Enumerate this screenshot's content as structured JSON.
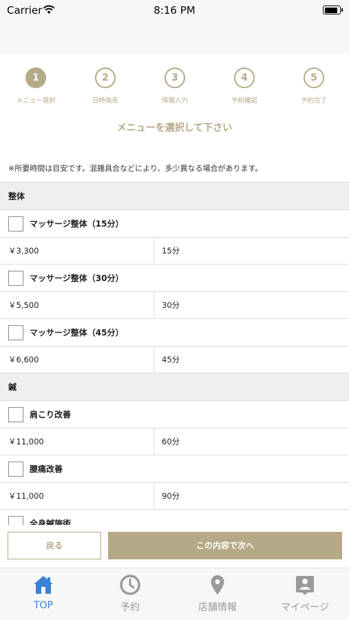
{
  "status_bar": {
    "carrier": "Carrier",
    "time": "8:16 PM"
  },
  "steps": [
    {
      "number": "1",
      "label": "メニュー選択"
    },
    {
      "number": "2",
      "label": "日時指名"
    },
    {
      "number": "3",
      "label": "情報入力"
    },
    {
      "number": "4",
      "label": "予約確認"
    },
    {
      "number": "5",
      "label": "予約完了"
    }
  ],
  "heading": "メニューを選択して下さい",
  "notice": "※所要時間は目安です。混雑具合などにより、多少異なる場合があります。",
  "categories": [
    {
      "name": "整体",
      "items": [
        {
          "name": "マッサージ整体（15分）",
          "price": "￥3,300",
          "duration": "15分"
        },
        {
          "name": "マッサージ整体（30分）",
          "price": "￥5,500",
          "duration": "30分"
        },
        {
          "name": "マッサージ整体（45分）",
          "price": "￥6,600",
          "duration": "45分"
        }
      ]
    },
    {
      "name": "鍼",
      "items": [
        {
          "name": "肩こり改善",
          "price": "￥11,000",
          "duration": "60分"
        },
        {
          "name": "腰痛改善",
          "price": "￥11,000",
          "duration": "90分"
        },
        {
          "name": "全身鍼施術"
        }
      ]
    }
  ],
  "buttons": {
    "back": "戻る",
    "next": "この内容で次へ"
  },
  "tabs": [
    {
      "label": "TOP",
      "icon": "home-icon",
      "active": true
    },
    {
      "label": "予約",
      "icon": "clock-icon"
    },
    {
      "label": "店舗情報",
      "icon": "map-pin-icon"
    },
    {
      "label": "マイページ",
      "icon": "person-badge-icon"
    }
  ],
  "colors": {
    "accent": "#b5a987",
    "active_tab": "#3b82d6",
    "inactive_tab": "#999999"
  }
}
